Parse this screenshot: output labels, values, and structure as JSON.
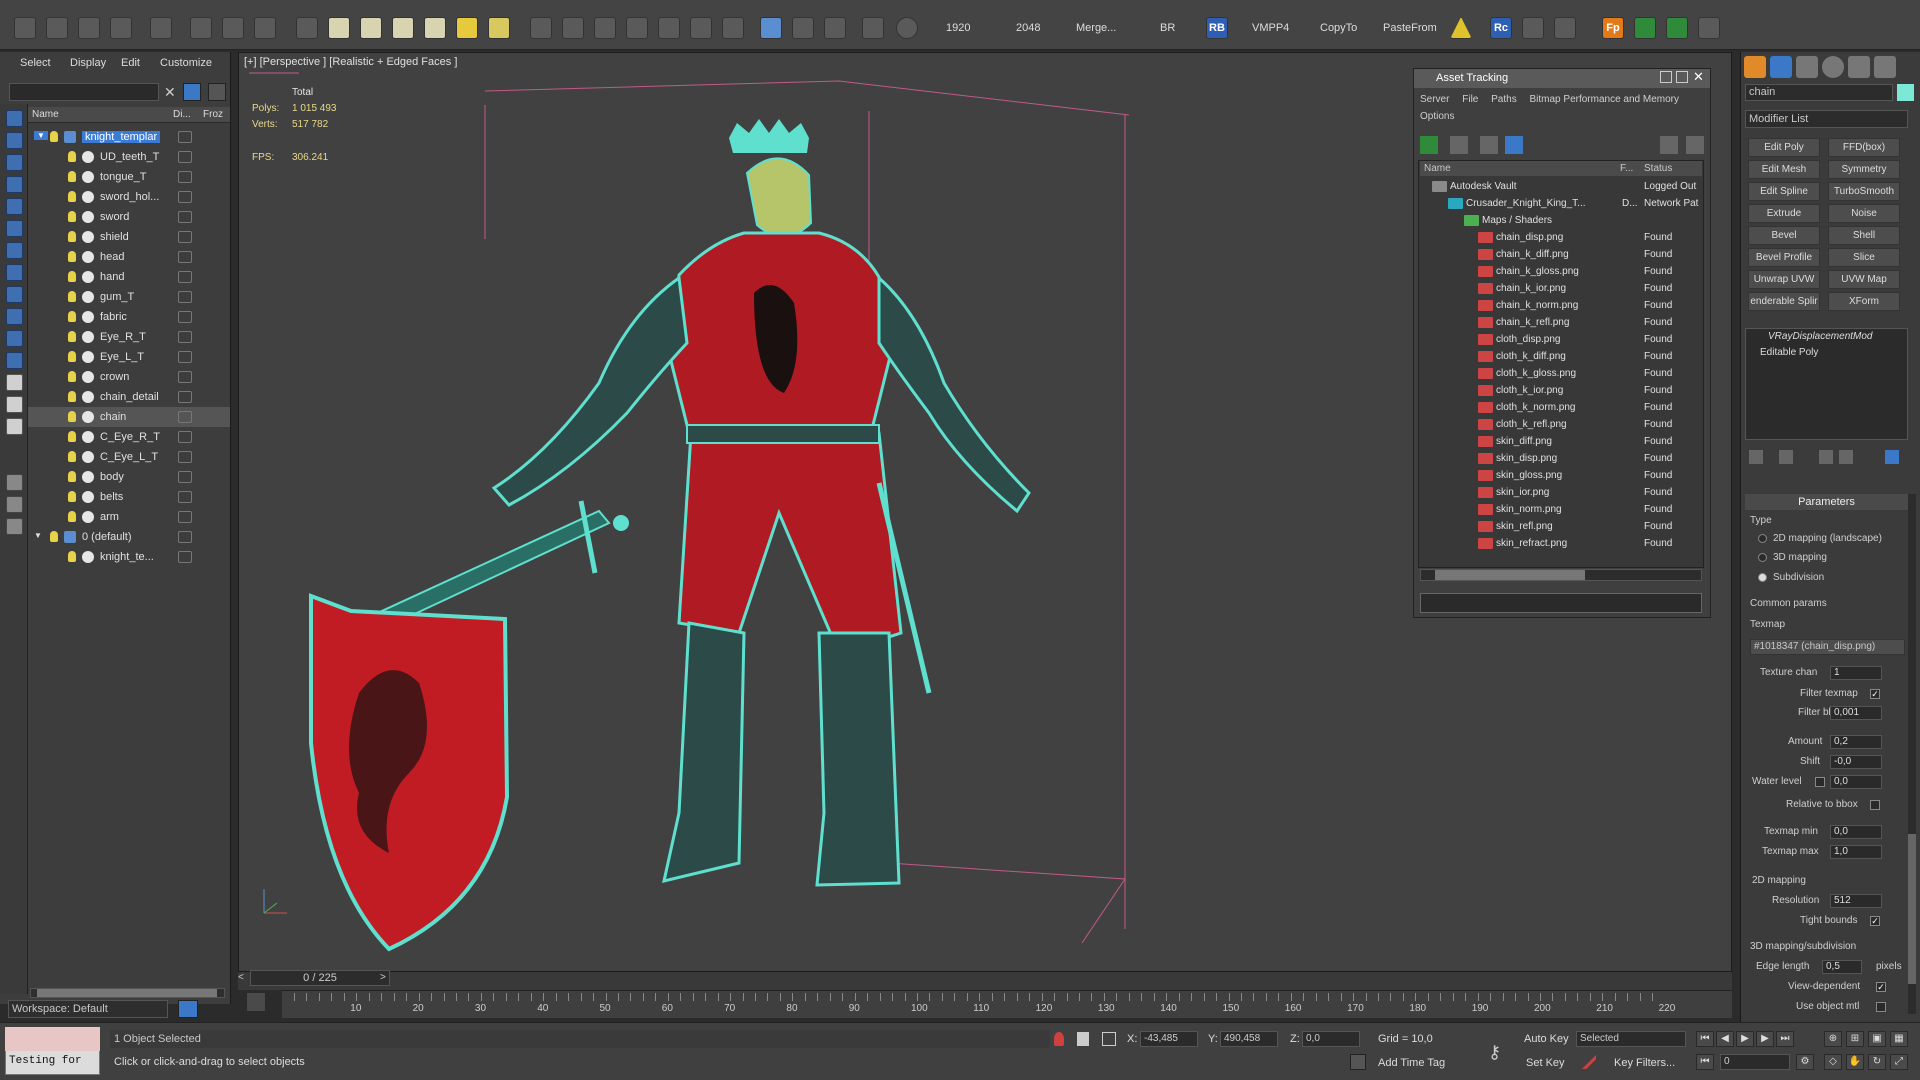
{
  "toolbar": {
    "labels": {
      "w": "1920",
      "h": "2048",
      "merge": "Merge...",
      "br": "BR",
      "rb": "RB",
      "vmpp": "VMPP4",
      "copyto": "CopyTo",
      "pastefrom": "PasteFrom",
      "rc": "Rc",
      "fp": "Fp"
    }
  },
  "scene": {
    "menu": [
      "Select",
      "Display",
      "Edit",
      "Customize"
    ],
    "columns": {
      "name": "Name",
      "di": "Di...",
      "froz": "Froz"
    },
    "items": [
      {
        "label": "knight_templar",
        "level": 1
      },
      {
        "label": "UD_teeth_T",
        "level": 2
      },
      {
        "label": "tongue_T",
        "level": 2
      },
      {
        "label": "sword_hol...",
        "level": 2
      },
      {
        "label": "sword",
        "level": 2
      },
      {
        "label": "shield",
        "level": 2
      },
      {
        "label": "head",
        "level": 2
      },
      {
        "label": "hand",
        "level": 2
      },
      {
        "label": "gum_T",
        "level": 2
      },
      {
        "label": "fabric",
        "level": 2
      },
      {
        "label": "Eye_R_T",
        "level": 2
      },
      {
        "label": "Eye_L_T",
        "level": 2
      },
      {
        "label": "crown",
        "level": 2
      },
      {
        "label": "chain_detail",
        "level": 2
      },
      {
        "label": "chain",
        "level": 2
      },
      {
        "label": "C_Eye_R_T",
        "level": 2
      },
      {
        "label": "C_Eye_L_T",
        "level": 2
      },
      {
        "label": "body",
        "level": 2
      },
      {
        "label": "belts",
        "level": 2
      },
      {
        "label": "arm",
        "level": 2
      },
      {
        "label": "0 (default)",
        "level": 1
      },
      {
        "label": "knight_te...",
        "level": 2
      }
    ],
    "workspace": "Workspace: Default"
  },
  "viewport": {
    "label": "[+] [Perspective ] [Realistic + Edged Faces ]",
    "stats": {
      "total_label": "Total",
      "polys_label": "Polys:",
      "polys_value": "1 015 493",
      "verts_label": "Verts:",
      "verts_value": "517 782",
      "fps_label": "FPS:",
      "fps_value": "306.241"
    }
  },
  "timeline": {
    "frame": "0 / 225",
    "ticks": [
      "10",
      "20",
      "30",
      "40",
      "50",
      "60",
      "70",
      "80",
      "90",
      "100",
      "110",
      "120",
      "130",
      "140",
      "150",
      "160",
      "170",
      "180",
      "190",
      "200",
      "210",
      "220"
    ]
  },
  "asset_tracking": {
    "title": "Asset Tracking",
    "menu1": [
      "Server",
      "File",
      "Paths",
      "Bitmap Performance and Memory"
    ],
    "menu2": "Options",
    "columns": {
      "name": "Name",
      "f": "F...",
      "status": "Status"
    },
    "rows": [
      {
        "name": "Autodesk Vault",
        "f": "",
        "status": "Logged Out",
        "kind": "vault"
      },
      {
        "name": "Crusader_Knight_King_T...",
        "f": "D...",
        "status": "Network Pat",
        "kind": "max"
      },
      {
        "name": "Maps / Shaders",
        "f": "",
        "status": "",
        "kind": "folder"
      },
      {
        "name": "chain_disp.png",
        "f": "",
        "status": "Found",
        "kind": "png"
      },
      {
        "name": "chain_k_diff.png",
        "f": "",
        "status": "Found",
        "kind": "png"
      },
      {
        "name": "chain_k_gloss.png",
        "f": "",
        "status": "Found",
        "kind": "png"
      },
      {
        "name": "chain_k_ior.png",
        "f": "",
        "status": "Found",
        "kind": "png"
      },
      {
        "name": "chain_k_norm.png",
        "f": "",
        "status": "Found",
        "kind": "png"
      },
      {
        "name": "chain_k_refl.png",
        "f": "",
        "status": "Found",
        "kind": "png"
      },
      {
        "name": "cloth_disp.png",
        "f": "",
        "status": "Found",
        "kind": "png"
      },
      {
        "name": "cloth_k_diff.png",
        "f": "",
        "status": "Found",
        "kind": "png"
      },
      {
        "name": "cloth_k_gloss.png",
        "f": "",
        "status": "Found",
        "kind": "png"
      },
      {
        "name": "cloth_k_ior.png",
        "f": "",
        "status": "Found",
        "kind": "png"
      },
      {
        "name": "cloth_k_norm.png",
        "f": "",
        "status": "Found",
        "kind": "png"
      },
      {
        "name": "cloth_k_refl.png",
        "f": "",
        "status": "Found",
        "kind": "png"
      },
      {
        "name": "skin_diff.png",
        "f": "",
        "status": "Found",
        "kind": "png"
      },
      {
        "name": "skin_disp.png",
        "f": "",
        "status": "Found",
        "kind": "png"
      },
      {
        "name": "skin_gloss.png",
        "f": "",
        "status": "Found",
        "kind": "png"
      },
      {
        "name": "skin_ior.png",
        "f": "",
        "status": "Found",
        "kind": "png"
      },
      {
        "name": "skin_norm.png",
        "f": "",
        "status": "Found",
        "kind": "png"
      },
      {
        "name": "skin_refl.png",
        "f": "",
        "status": "Found",
        "kind": "png"
      },
      {
        "name": "skin_refract.png",
        "f": "",
        "status": "Found",
        "kind": "png"
      }
    ]
  },
  "command_panel": {
    "object_name": "chain",
    "modifier_list": "Modifier List",
    "buttons": [
      [
        "Edit Poly",
        "FFD(box)"
      ],
      [
        "Edit Mesh",
        "Symmetry"
      ],
      [
        "Edit Spline",
        "TurboSmooth"
      ],
      [
        "Extrude",
        "Noise"
      ],
      [
        "Bevel",
        "Shell"
      ],
      [
        "Bevel Profile",
        "Slice"
      ],
      [
        "Unwrap UVW",
        "UVW Map"
      ],
      [
        "enderable Splir",
        "XForm"
      ]
    ],
    "stack": [
      "VRayDisplacementMod",
      "Editable Poly"
    ],
    "params": {
      "header": "Parameters",
      "type": "Type",
      "type_options": [
        "2D mapping (landscape)",
        "3D mapping",
        "Subdivision"
      ],
      "common": "Common params",
      "texmap_label": "Texmap",
      "texmap_value": "#1018347 (chain_disp.png)",
      "texture_chan_label": "Texture chan",
      "texture_chan": "1",
      "filter_texmap": "Filter texmap",
      "filter_blur_label": "Filter blur",
      "filter_blur": "0,001",
      "amount_label": "Amount",
      "amount": "0,2",
      "shift_label": "Shift",
      "shift": "-0,0",
      "water_label": "Water level",
      "water": "0,0",
      "relative_label": "Relative to bbox",
      "texmap_min_label": "Texmap min",
      "texmap_min": "0,0",
      "texmap_max_label": "Texmap max",
      "texmap_max": "1,0",
      "mapping2d": "2D mapping",
      "resolution_label": "Resolution",
      "resolution": "512",
      "tight_label": "Tight bounds",
      "mapping3d": "3D mapping/subdivision",
      "edge_label": "Edge length",
      "edge": "0,5",
      "pixels": "pixels",
      "view_dep": "View-dependent",
      "use_obj": "Use object mtl"
    }
  },
  "status": {
    "script": "Testing for",
    "selected": "1 Object Selected",
    "prompt": "Click or click-and-drag to select objects",
    "x_label": "X:",
    "x": "-43,485",
    "y_label": "Y:",
    "y": "490,458",
    "z_label": "Z:",
    "z": "0,0",
    "grid": "Grid = 10,0",
    "add_time_tag": "Add Time Tag",
    "auto_key": "Auto Key",
    "set_key": "Set Key",
    "selected_dd": "Selected",
    "key_filters": "Key Filters...",
    "frame_field": "0"
  }
}
